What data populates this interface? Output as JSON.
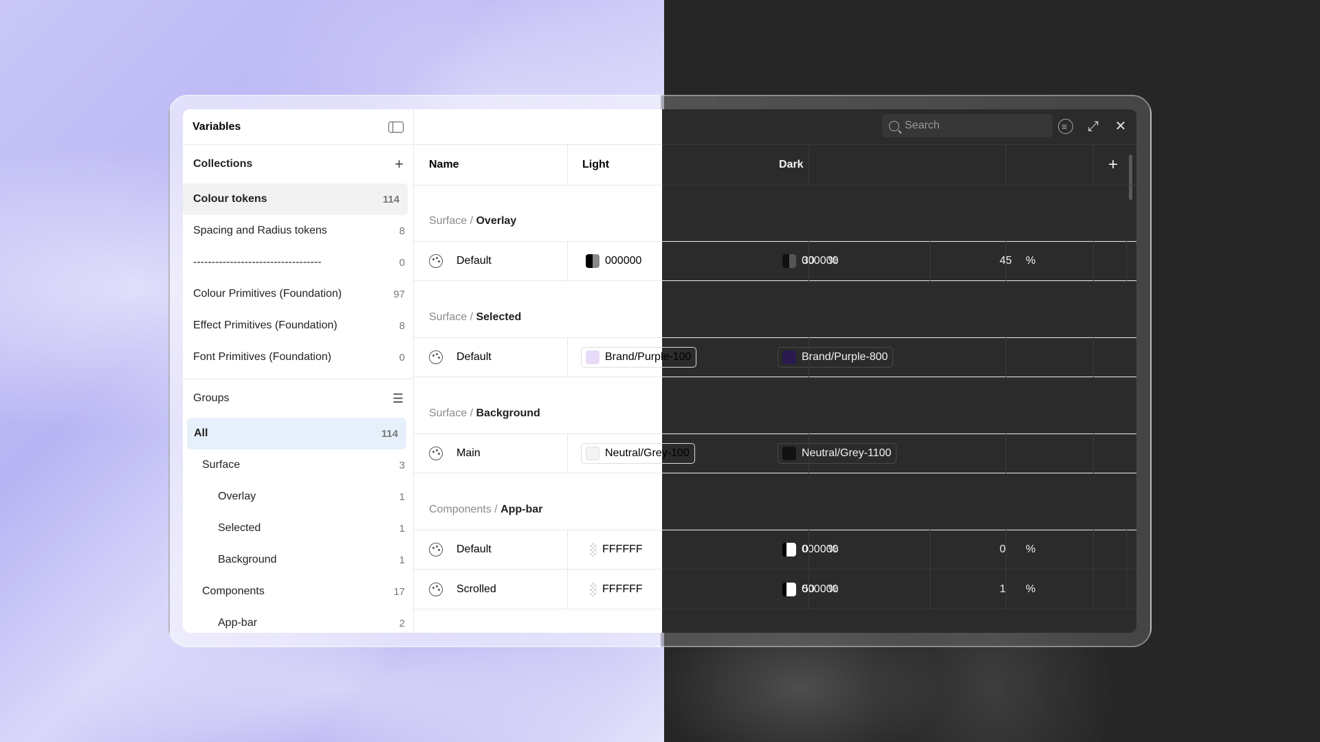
{
  "window": {
    "title": "Variables"
  },
  "collections": {
    "header": "Collections",
    "items": [
      {
        "label": "Colour tokens",
        "count": "114"
      },
      {
        "label": "Spacing and Radius tokens",
        "count": "8"
      },
      {
        "label": "-----------------------------------",
        "count": "0"
      },
      {
        "label": "Colour Primitives (Foundation)",
        "count": "97"
      },
      {
        "label": "Effect Primitives (Foundation)",
        "count": "8"
      },
      {
        "label": "Font Primitives (Foundation)",
        "count": "0"
      }
    ]
  },
  "groups": {
    "header": "Groups",
    "items": [
      {
        "label": "All",
        "count": "114"
      },
      {
        "label": "Surface",
        "count": "3"
      },
      {
        "label": "Overlay",
        "count": "1"
      },
      {
        "label": "Selected",
        "count": "1"
      },
      {
        "label": "Background",
        "count": "1"
      },
      {
        "label": "Components",
        "count": "17"
      },
      {
        "label": "App-bar",
        "count": "2"
      }
    ]
  },
  "toolbar": {
    "search_placeholder": "Search"
  },
  "table": {
    "columns": {
      "name": "Name",
      "light": "Light",
      "dark": "Dark"
    },
    "groups": [
      {
        "prefix": "Surface / ",
        "name": "Overlay"
      },
      {
        "prefix": "Surface / ",
        "name": "Selected"
      },
      {
        "prefix": "Surface / ",
        "name": "Background"
      },
      {
        "prefix": "Components / ",
        "name": "App-bar"
      }
    ],
    "rows": [
      {
        "name": "Default",
        "light_value": "000000",
        "light_pct": "30",
        "dark_value": "000000",
        "dark_pct": "45",
        "pct_symbol": "%"
      },
      {
        "name": "Default",
        "light_value": "Brand/Purple-100",
        "dark_value": "Brand/Purple-800",
        "light_color": "#e7dcf7",
        "dark_color": "#2a1a4f"
      },
      {
        "name": "Main",
        "light_value": "Neutral/Grey-100",
        "dark_value": "Neutral/Grey-1100",
        "light_color": "#f3f3f3",
        "dark_color": "#111111"
      },
      {
        "name": "Default",
        "light_value": "FFFFFF",
        "light_pct": "0",
        "dark_value": "000000",
        "dark_pct": "0",
        "pct_symbol": "%"
      },
      {
        "name": "Scrolled",
        "light_value": "FFFFFF",
        "light_pct": "50",
        "dark_value": "000000",
        "dark_pct": "1",
        "pct_symbol": "%"
      }
    ]
  }
}
